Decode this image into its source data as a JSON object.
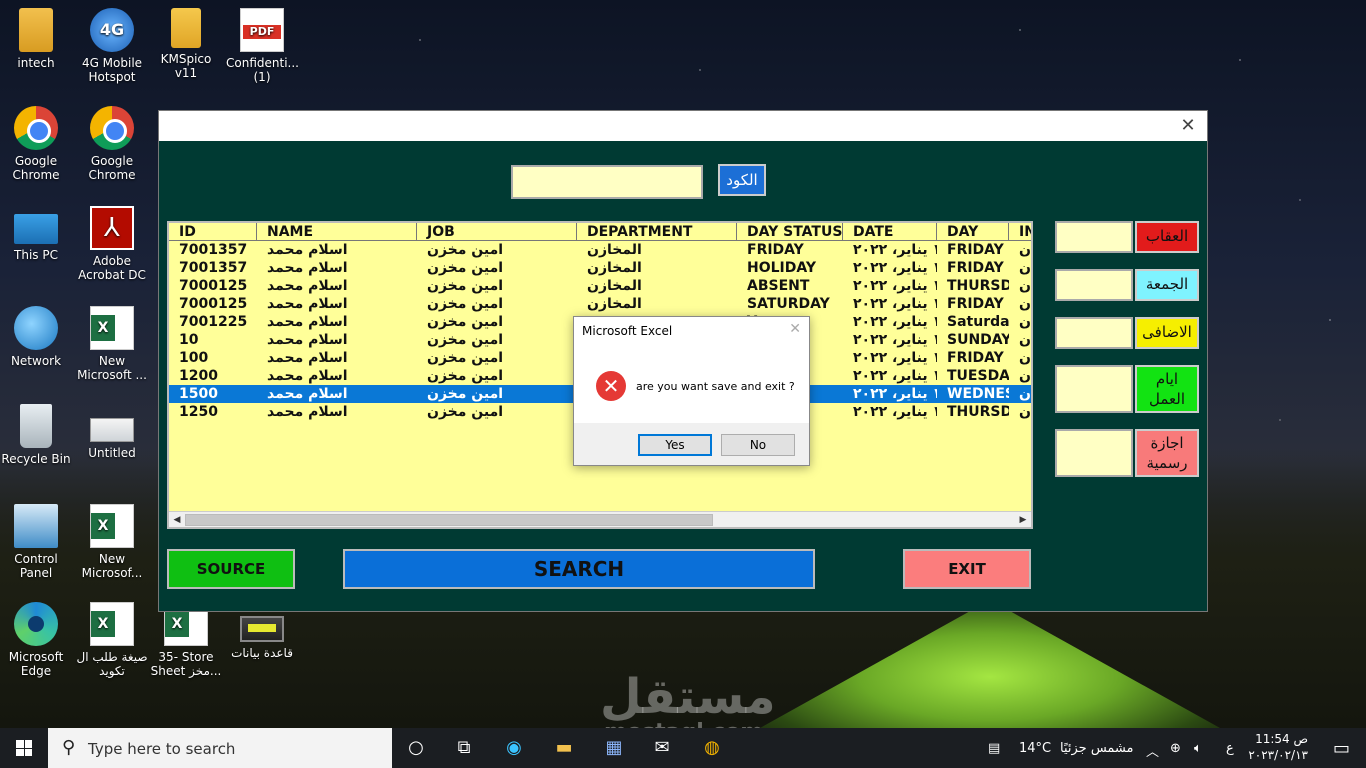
{
  "desktop": {
    "icons": [
      {
        "label": "intech"
      },
      {
        "label": "4G Mobile Hotspot",
        "badge": "4G"
      },
      {
        "label": "KMSpico v11"
      },
      {
        "label": "Confidenti... (1)",
        "badge": "PDF"
      },
      {
        "label": "Google Chrome"
      },
      {
        "label": "Google Chrome"
      },
      {
        "label": "This PC"
      },
      {
        "label": "Adobe Acrobat DC"
      },
      {
        "label": "Network"
      },
      {
        "label": "New Microsoft ...",
        "badge": "X"
      },
      {
        "label": "Recycle Bin"
      },
      {
        "label": "Untitled"
      },
      {
        "label": "Control Panel"
      },
      {
        "label": "New Microsof...",
        "badge": "X"
      },
      {
        "label": "Microsoft Edge"
      },
      {
        "label": "صيغة طلب ال تكويد",
        "badge": "X"
      },
      {
        "label": "35- Store Sheet مخز...",
        "badge": "X"
      },
      {
        "label": "قاعدة بيانات"
      }
    ]
  },
  "form": {
    "close_glyph": "✕",
    "code_input_value": "",
    "code_button": "الكود",
    "columns": [
      "ID",
      "NAME",
      "JOB",
      "DEPARTMENT",
      "DAY STATUS",
      "DATE",
      "DAY",
      "IN"
    ],
    "rows": [
      [
        "7001357",
        "اسلام محمد",
        "امين مخزن",
        "المخازن",
        "FRIDAY",
        "١ يناير، ٢٠٢٢",
        "FRIDAY",
        "ن"
      ],
      [
        "7001357",
        "اسلام محمد",
        "امين مخزن",
        "المخازن",
        "HOLIDAY",
        "١ يناير، ٢٠٢٢",
        "FRIDAY",
        "ن"
      ],
      [
        "7000125",
        "اسلام محمد",
        "امين مخزن",
        "المخازن",
        "ABSENT",
        "١ يناير، ٢٠٢٢",
        "THURSD",
        "ن"
      ],
      [
        "7000125",
        "اسلام محمد",
        "امين مخزن",
        "المخازن",
        "SATURDAY",
        "١ يناير، ٢٠٢٢",
        "FRIDAY",
        "ن"
      ],
      [
        "7001225",
        "اسلام محمد",
        "امين مخزن",
        "",
        "Y",
        "١ يناير، ٢٠٢٢",
        "Saturday",
        "ن"
      ],
      [
        "10",
        "اسلام محمد",
        "امين مخزن",
        "",
        "",
        "١ يناير، ٢٠٢٢",
        "SUNDAY",
        "ن"
      ],
      [
        "100",
        "اسلام محمد",
        "امين مخزن",
        "",
        "",
        "١ يناير، ٢٠٢٢",
        "FRIDAY",
        "ن"
      ],
      [
        "1200",
        "اسلام محمد",
        "امين مخزن",
        "",
        "Y",
        "١ يناير، ٢٠٢٢",
        "TUESDA'",
        "ن"
      ],
      [
        "1500",
        "اسلام محمد",
        "امين مخزن",
        "",
        "",
        "١ يناير، ٢٠٢٢",
        "WEDNES",
        "ن"
      ],
      [
        "1250",
        "اسلام محمد",
        "امين مخزن",
        "",
        "",
        "١ يناير، ٢٠٢٢",
        "THURSD",
        "ن"
      ]
    ],
    "selected_row_index": 8,
    "side_fields": [
      {
        "label": "العقاب",
        "color": "#e21b1b"
      },
      {
        "label": "الجمعة",
        "color": "#7ff3ff"
      },
      {
        "label": "الاضافى",
        "color": "#f6ef00"
      },
      {
        "label": "ايام العمل",
        "color": "#12e312"
      },
      {
        "label": "اجازة رسمية",
        "color": "#f87a7a"
      }
    ],
    "buttons": {
      "source": "SOURCE",
      "search": "SEARCH",
      "exit": "EXIT"
    },
    "colors": {
      "background": "#003a33",
      "grid": "#ffff99",
      "selected_row": "#0a78d6",
      "source": "#0fbf12",
      "search": "#0a6fd8",
      "exit": "#fb7d7d"
    }
  },
  "dialog": {
    "title": "Microsoft Excel",
    "close_glyph": "✕",
    "message": "are you want save and exit ?",
    "yes": "Yes",
    "no": "No"
  },
  "taskbar": {
    "search_placeholder": "Type here to search",
    "weather_temp": "14°C",
    "weather_text": "مشمس جزئيًا",
    "lang": "ع",
    "time": "11:54 ص",
    "date": "٢٠٢٣/٠٢/١٣"
  },
  "watermark": {
    "arabic": "مستقل",
    "latin": "mostaql.com"
  }
}
